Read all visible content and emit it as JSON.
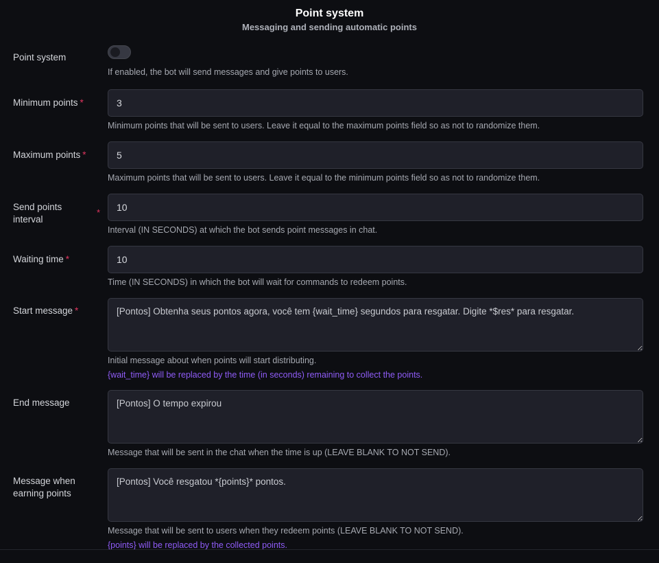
{
  "header": {
    "title": "Point system",
    "subtitle": "Messaging and sending automatic points"
  },
  "fields": {
    "point_system": {
      "label": "Point system",
      "enabled": false,
      "help": "If enabled, the bot will send messages and give points to users."
    },
    "minimum_points": {
      "label": "Minimum points",
      "required_mark": "*",
      "value": "3",
      "help": "Minimum points that will be sent to users. Leave it equal to the maximum points field so as not to randomize them."
    },
    "maximum_points": {
      "label": "Maximum points",
      "required_mark": "*",
      "value": "5",
      "help": "Maximum points that will be sent to users. Leave it equal to the minimum points field so as not to randomize them."
    },
    "send_points_interval": {
      "label": "Send points interval",
      "required_mark": "*",
      "value": "10",
      "help": "Interval (IN SECONDS) at which the bot sends point messages in chat."
    },
    "waiting_time": {
      "label": "Waiting time",
      "required_mark": "*",
      "value": "10",
      "help": "Time (IN SECONDS) in which the bot will wait for commands to redeem points."
    },
    "start_message": {
      "label": "Start message",
      "required_mark": "*",
      "value": "[Pontos] Obtenha seus pontos agora, você tem {wait_time} segundos para resgatar. Digite *$res* para resgatar.",
      "help": "Initial message about when points will start distributing.",
      "hint": "{wait_time} will be replaced by the time (in seconds) remaining to collect the points."
    },
    "end_message": {
      "label": "End message",
      "value": "[Pontos] O tempo expirou",
      "help": "Message that will be sent in the chat when the time is up (LEAVE BLANK TO NOT SEND)."
    },
    "earning_message": {
      "label": "Message when earning points",
      "value": "[Pontos] Você resgatou *{points}* pontos.",
      "help": "Message that will be sent to users when they redeem points (LEAVE BLANK TO NOT SEND).",
      "hint": "{points} will be replaced by the collected points."
    }
  }
}
